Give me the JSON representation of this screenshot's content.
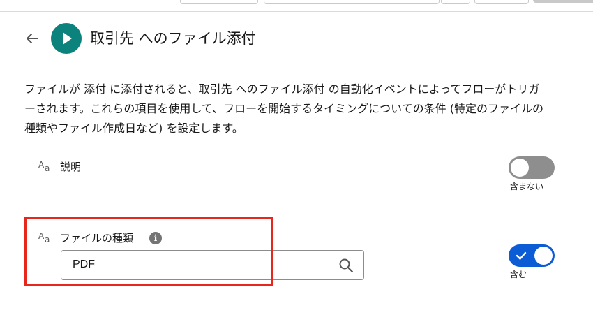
{
  "header": {
    "title": "取引先 へのファイル添付"
  },
  "description": {
    "line1": "ファイルが 添付 に添付されると、取引先 へのファイル添付 の自動化イベントによってフローがトリガ",
    "line2": "ーされます。これらの項目を使用して、フローを開始するタイミングについての条件 (特定のファイルの",
    "line3": "種類やファイル作成日など) を設定します。"
  },
  "fields": {
    "description_field": {
      "label": "説明",
      "toggle_state": "off",
      "toggle_label": "含まない"
    },
    "file_type_field": {
      "label": "ファイルの種類",
      "value": "PDF",
      "toggle_state": "on",
      "toggle_label": "含む"
    }
  },
  "colors": {
    "accent": "#0b827c",
    "toggle_on": "#0b5cd5",
    "toggle_off": "#8e8e8e",
    "highlight": "#e8271c"
  },
  "icons": [
    "back-arrow-icon",
    "play-icon",
    "text-type-icon",
    "info-icon",
    "search-icon",
    "checkmark-icon"
  ]
}
